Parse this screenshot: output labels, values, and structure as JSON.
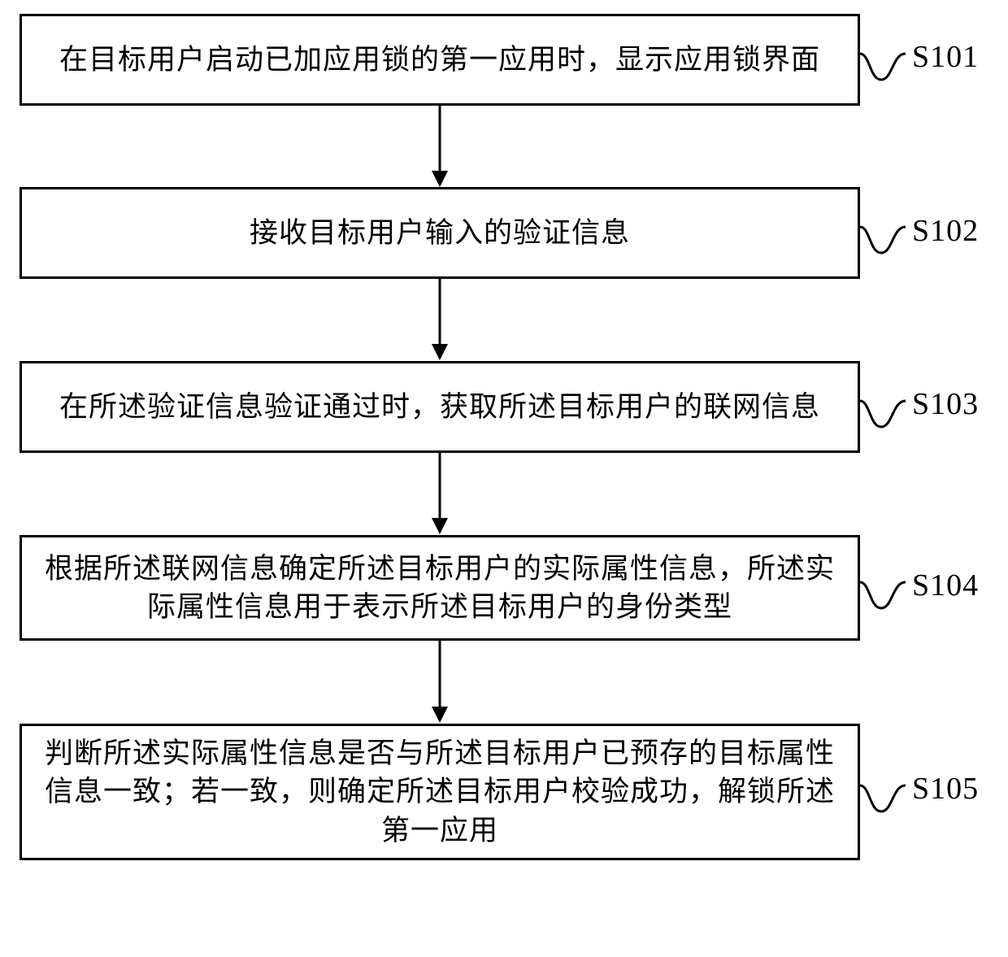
{
  "diagram": {
    "type": "flowchart",
    "direction": "top-to-bottom",
    "steps": [
      {
        "id": "S101",
        "text": "在目标用户启动已加应用锁的第一应用时，显示应用锁界面",
        "label": "S101"
      },
      {
        "id": "S102",
        "text": "接收目标用户输入的验证信息",
        "label": "S102"
      },
      {
        "id": "S103",
        "text": "在所述验证信息验证通过时，获取所述目标用户的联网信息",
        "label": "S103"
      },
      {
        "id": "S104",
        "text": "根据所述联网信息确定所述目标用户的实际属性信息，所述实际属性信息用于表示所述目标用户的身份类型",
        "label": "S104"
      },
      {
        "id": "S105",
        "text": "判断所述实际属性信息是否与所述目标用户已预存的目标属性信息一致；若一致，则确定所述目标用户校验成功，解锁所述第一应用",
        "label": "S105"
      }
    ]
  }
}
